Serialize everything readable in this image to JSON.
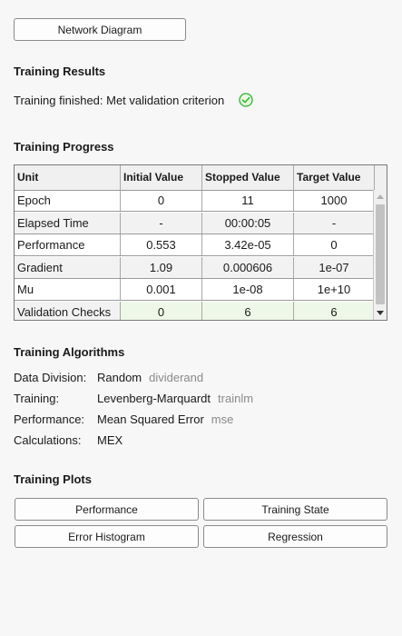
{
  "network_diagram_button": "Network Diagram",
  "results": {
    "heading": "Training Results",
    "status": "Training finished: Met validation criterion",
    "status_color": "#2db52d"
  },
  "progress": {
    "heading": "Training Progress",
    "columns": [
      "Unit",
      "Initial Value",
      "Stopped Value",
      "Target Value"
    ],
    "rows": [
      {
        "unit": "Epoch",
        "initial": "0",
        "stopped": "11",
        "target": "1000"
      },
      {
        "unit": "Elapsed Time",
        "initial": "-",
        "stopped": "00:00:05",
        "target": "-"
      },
      {
        "unit": "Performance",
        "initial": "0.553",
        "stopped": "3.42e-05",
        "target": "0"
      },
      {
        "unit": "Gradient",
        "initial": "1.09",
        "stopped": "0.000606",
        "target": "1e-07"
      },
      {
        "unit": "Mu",
        "initial": "0.001",
        "stopped": "1e-08",
        "target": "1e+10"
      },
      {
        "unit": "Validation Checks",
        "initial": "0",
        "stopped": "6",
        "target": "6"
      }
    ]
  },
  "algorithms": {
    "heading": "Training Algorithms",
    "items": [
      {
        "label": "Data Division:",
        "value": "Random",
        "code": "dividerand"
      },
      {
        "label": "Training:",
        "value": "Levenberg-Marquardt",
        "code": "trainlm"
      },
      {
        "label": "Performance:",
        "value": "Mean Squared Error",
        "code": "mse"
      },
      {
        "label": "Calculations:",
        "value": "MEX",
        "code": ""
      }
    ]
  },
  "plots": {
    "heading": "Training Plots",
    "buttons": [
      "Performance",
      "Training State",
      "Error Histogram",
      "Regression"
    ]
  }
}
